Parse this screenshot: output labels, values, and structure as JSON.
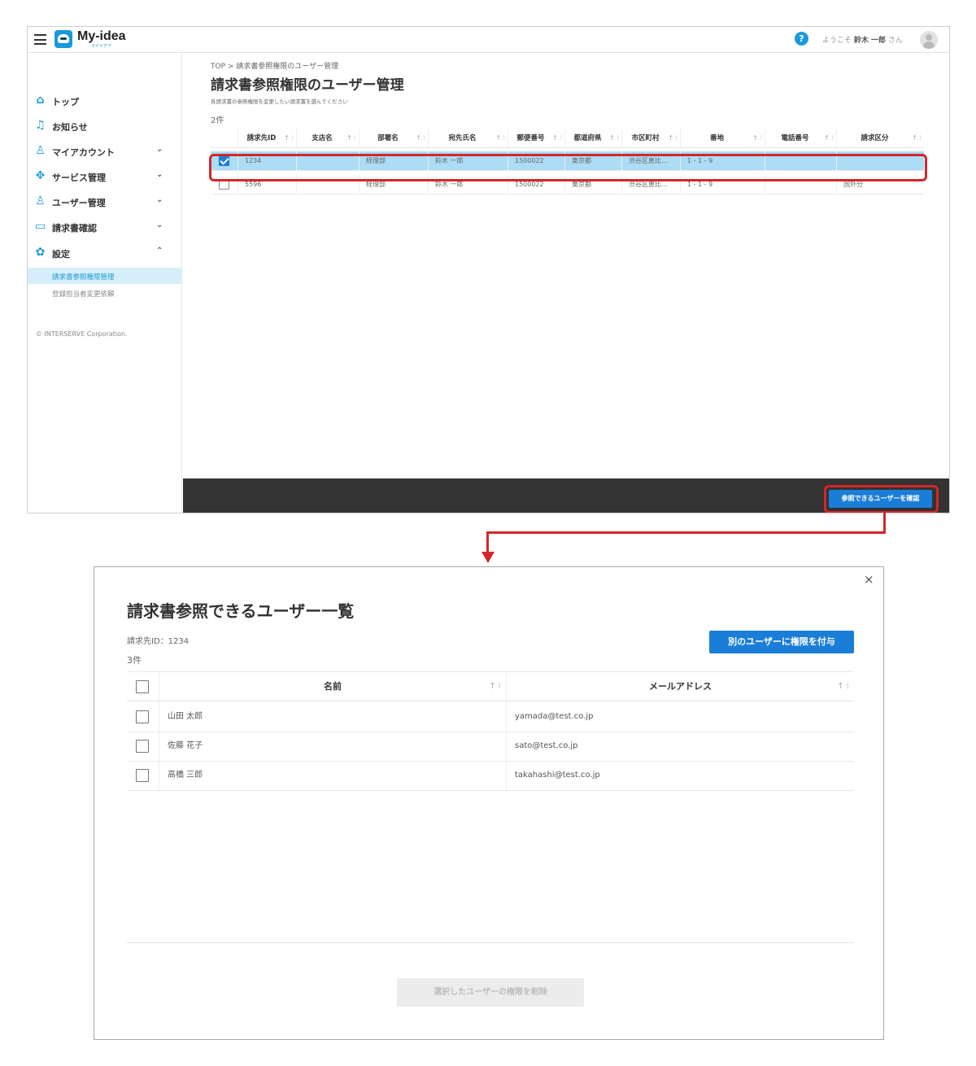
{
  "header": {
    "logo_text": "My-idea",
    "logo_sub": "マイイデア",
    "help_icon": "?",
    "welcome_prefix": "ようこそ",
    "user_name": "鈴木 一郎",
    "welcome_suffix": "さん"
  },
  "sidebar": {
    "items": [
      {
        "label": "トップ",
        "icon": "home-icon",
        "glyph": "⌂"
      },
      {
        "label": "お知らせ",
        "icon": "bell-icon",
        "glyph": "♫"
      },
      {
        "label": "マイアカウント",
        "icon": "user-icon",
        "glyph": "♙"
      },
      {
        "label": "サービス管理",
        "icon": "service-icon",
        "glyph": "✥"
      },
      {
        "label": "ユーザー管理",
        "icon": "users-icon",
        "glyph": "♙"
      },
      {
        "label": "請求書確認",
        "icon": "card-icon",
        "glyph": "▭"
      },
      {
        "label": "設定",
        "icon": "gear-icon",
        "glyph": "✿"
      }
    ],
    "chevrons": {
      "down": "⌄",
      "up": "⌃"
    },
    "sub_items": [
      {
        "label": "請求書参照権限管理"
      },
      {
        "label": "登録担当者変更依頼"
      }
    ],
    "copyright": "© INTERSERVE Corporation."
  },
  "main": {
    "breadcrumb": "TOP > 請求書参照権限のユーザー管理",
    "title": "請求書参照権限のユーザー管理",
    "description": "各請求書の参照権限を変更したい請求書を選んでください",
    "count": "2件",
    "sort_icon": "↑ ⁝",
    "columns": [
      "",
      "請求先ID",
      "支店名",
      "部署名",
      "宛先氏名",
      "郵便番号",
      "都道府県",
      "市区町村",
      "番地",
      "電話番号",
      "請求区分"
    ],
    "rows": [
      {
        "checked": true,
        "cells": [
          "1234",
          "",
          "経理部",
          "鈴木 一郎",
          "1500022",
          "東京都",
          "渋谷区恵比…",
          "1 - 1 - 9",
          "",
          ""
        ]
      },
      {
        "checked": false,
        "cells": [
          "5596",
          "",
          "経理部",
          "鈴木 一郎",
          "1500022",
          "東京都",
          "渋谷区恵比…",
          "1 - 1 - 9",
          "",
          "国外分"
        ]
      }
    ],
    "confirm_button": "参照できるユーザーを確認"
  },
  "modal": {
    "close_icon": "×",
    "title": "請求書参照できるユーザー一覧",
    "invoice_id": "請求先ID：1234",
    "count": "3件",
    "grant_button": "別のユーザーに権限を付与",
    "sort_icon": "↑ ⁝",
    "columns": [
      "",
      "名前",
      "メールアドレス"
    ],
    "rows": [
      {
        "name": "山田 太郎",
        "email": "yamada@test.co.jp"
      },
      {
        "name": "佐藤 花子",
        "email": "sato@test.co.jp"
      },
      {
        "name": "高橋 三郎",
        "email": "takahashi@test.co.jp"
      }
    ],
    "delete_button": "選択したユーザーの権限を削除"
  },
  "colors": {
    "accent": "#1a7ed8",
    "brand": "#1a9ad8",
    "highlight": "#d4262b",
    "selected_row": "#acdcf6",
    "footer_bar": "#333333"
  }
}
